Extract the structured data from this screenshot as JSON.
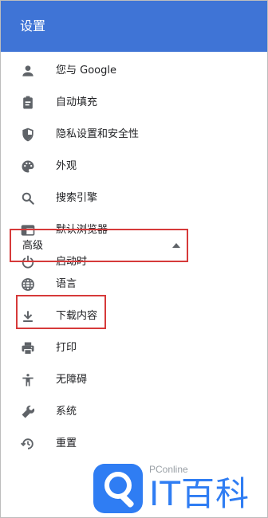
{
  "header": {
    "title": "设置"
  },
  "nav": {
    "items": [
      {
        "label": "您与 Google",
        "icon": "person-icon"
      },
      {
        "label": "自动填充",
        "icon": "clipboard-icon"
      },
      {
        "label": "隐私设置和安全性",
        "icon": "shield-icon"
      },
      {
        "label": "外观",
        "icon": "palette-icon"
      },
      {
        "label": "搜索引擎",
        "icon": "search-icon"
      },
      {
        "label": "默认浏览器",
        "icon": "browser-icon"
      },
      {
        "label": "启动时",
        "icon": "power-icon"
      }
    ],
    "advanced_label": "高级",
    "advanced_items": [
      {
        "label": "语言",
        "icon": "globe-icon"
      },
      {
        "label": "下载内容",
        "icon": "download-icon"
      },
      {
        "label": "打印",
        "icon": "printer-icon"
      },
      {
        "label": "无障碍",
        "icon": "accessibility-icon"
      },
      {
        "label": "系统",
        "icon": "wrench-icon"
      },
      {
        "label": "重置",
        "icon": "history-icon"
      }
    ]
  },
  "watermark": {
    "brand": "PConline",
    "text": "IT百科"
  },
  "colors": {
    "header": "#3f74d6",
    "highlight": "#d63a3a",
    "icon": "#5f6368",
    "watermark": "#2f7df3"
  }
}
